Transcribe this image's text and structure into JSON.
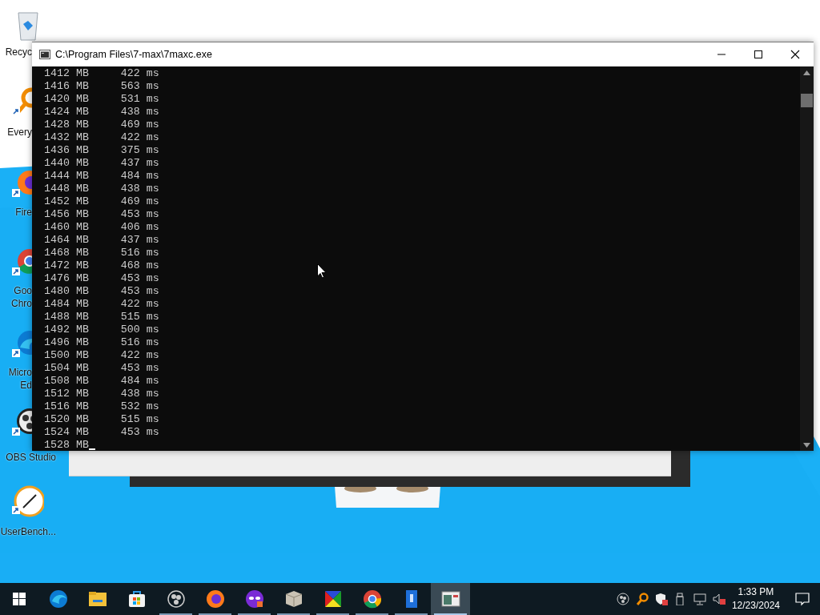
{
  "desktop": {
    "icons": [
      {
        "lines": [
          "Recyc"
        ]
      },
      {
        "lines": [
          "Every"
        ]
      },
      {
        "lines": [
          "Fire"
        ]
      },
      {
        "lines": [
          "Goo",
          "Chro"
        ]
      },
      {
        "lines": [
          "Micro",
          "Ed"
        ]
      },
      {
        "lines": [
          "OBS Studio"
        ]
      },
      {
        "lines": [
          "UserBench..."
        ]
      }
    ]
  },
  "console": {
    "title": "C:\\Program Files\\7-max\\7maxc.exe",
    "lines": [
      "1412 MB     422 ms",
      "1416 MB     563 ms",
      "1420 MB     531 ms",
      "1424 MB     438 ms",
      "1428 MB     469 ms",
      "1432 MB     422 ms",
      "1436 MB     375 ms",
      "1440 MB     437 ms",
      "1444 MB     484 ms",
      "1448 MB     438 ms",
      "1452 MB     469 ms",
      "1456 MB     453 ms",
      "1460 MB     406 ms",
      "1464 MB     437 ms",
      "1468 MB     516 ms",
      "1472 MB     468 ms",
      "1476 MB     453 ms",
      "1480 MB     453 ms",
      "1484 MB     422 ms",
      "1488 MB     515 ms",
      "1492 MB     500 ms",
      "1496 MB     516 ms",
      "1500 MB     422 ms",
      "1504 MB     453 ms",
      "1508 MB     484 ms",
      "1512 MB     438 ms",
      "1516 MB     532 ms",
      "1520 MB     515 ms",
      "1524 MB     453 ms",
      "1528 MB"
    ]
  },
  "taskbar": {
    "apps": [
      {
        "running": false,
        "active": false
      },
      {
        "running": false,
        "active": false
      },
      {
        "running": false,
        "active": false
      },
      {
        "running": true,
        "active": false
      },
      {
        "running": true,
        "active": false
      },
      {
        "running": true,
        "active": false
      },
      {
        "running": true,
        "active": false
      },
      {
        "running": true,
        "active": false
      },
      {
        "running": true,
        "active": false
      },
      {
        "running": true,
        "active": false
      },
      {
        "running": true,
        "active": true
      }
    ],
    "time": "1:33 PM",
    "date": "12/23/2024"
  }
}
